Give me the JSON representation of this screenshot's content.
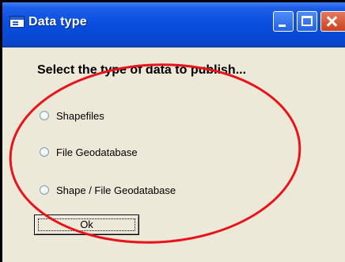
{
  "window": {
    "title": "Data type"
  },
  "prompt": "Select the type of data to publish...",
  "options": [
    {
      "label": "Shapefiles",
      "selected": false
    },
    {
      "label": "File Geodatabase",
      "selected": false
    },
    {
      "label": "Shape / File Geodatabase",
      "selected": false
    }
  ],
  "ok_button": {
    "label": "Ok"
  },
  "colors": {
    "titlebar": "#0a4fe0",
    "dialog_bg": "#ece9d8",
    "annotation_ellipse": "#e8141c"
  }
}
